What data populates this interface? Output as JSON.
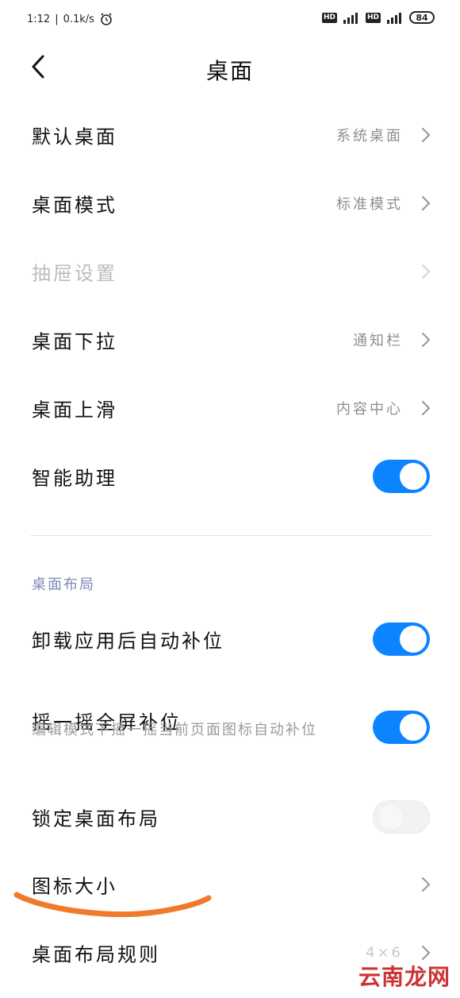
{
  "status": {
    "time": "1:12",
    "speed": "0.1k/s",
    "hd1": "HD",
    "hd2": "HD",
    "battery": "84"
  },
  "header": {
    "title": "桌面"
  },
  "items": [
    {
      "label": "默认桌面",
      "value": "系统桌面"
    },
    {
      "label": "桌面模式",
      "value": "标准模式"
    },
    {
      "label": "抽屉设置",
      "value": ""
    },
    {
      "label": "桌面下拉",
      "value": "通知栏"
    },
    {
      "label": "桌面上滑",
      "value": "内容中心"
    },
    {
      "label": "智能助理",
      "toggle": true
    }
  ],
  "section": {
    "title": "桌面布局"
  },
  "layout_items": [
    {
      "label": "卸载应用后自动补位",
      "toggle": true
    },
    {
      "label": "摇一摇全屏补位",
      "subtitle": "编辑模式下摇一摇当前页面图标自动补位",
      "toggle": true
    },
    {
      "label": "锁定桌面布局",
      "toggle": false
    },
    {
      "label": "图标大小"
    },
    {
      "label": "桌面布局规则",
      "value": "4×6"
    }
  ],
  "watermark": {
    "text": "云南龙网"
  },
  "colors": {
    "accent": "#0d84ff",
    "annotation": "#f07a2a"
  }
}
